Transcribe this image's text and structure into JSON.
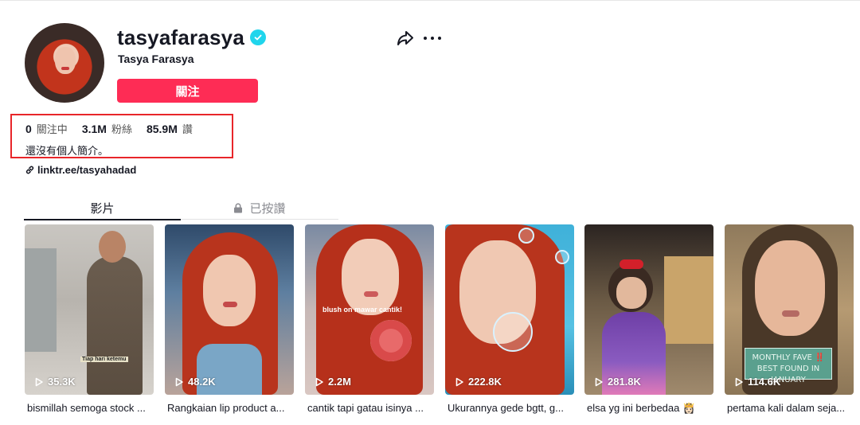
{
  "profile": {
    "username": "tasyafarasya",
    "nickname": "Tasya Farasya",
    "follow_label": "關注",
    "stats": [
      {
        "value": "0",
        "label": "關注中"
      },
      {
        "value": "3.1M",
        "label": "粉絲"
      },
      {
        "value": "85.9M",
        "label": "讚"
      }
    ],
    "bio": "還沒有個人簡介。",
    "link": "linktr.ee/tasyahadad"
  },
  "tabs": {
    "videos": "影片",
    "liked": "已按讚"
  },
  "videos": [
    {
      "views": "35.3K",
      "caption": "bismillah semoga stock ...",
      "overlay": "Tiap hari ketemu"
    },
    {
      "views": "48.2K",
      "caption": "Rangkaian lip product a...",
      "overlay": ""
    },
    {
      "views": "2.2M",
      "caption": "cantik tapi gatau isinya ...",
      "overlay": "blush on mawar cantik!"
    },
    {
      "views": "222.8K",
      "caption": "Ukurannya gede bgtt, g...",
      "overlay": ""
    },
    {
      "views": "281.8K",
      "caption": "elsa yg ini berbedaa 👸🏻",
      "overlay": ""
    },
    {
      "views": "114.6K",
      "caption": "pertama kali dalam seja...",
      "overlay": "MONTHLY FAVE ‼️ BEST FOUND IN JANUARY"
    }
  ],
  "colors": {
    "accent": "#fe2c55",
    "verified": "#20d5ec",
    "highlight": "#e8262a"
  }
}
